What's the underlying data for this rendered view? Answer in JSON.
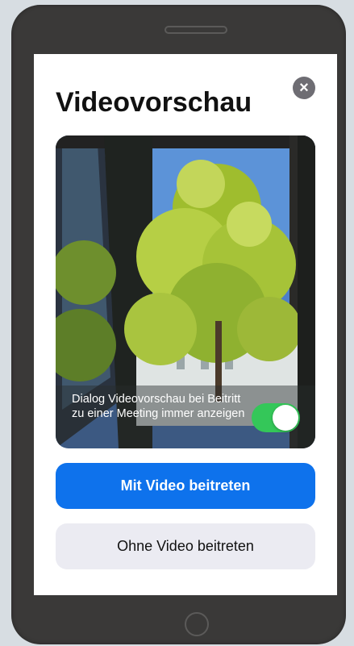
{
  "dialog": {
    "title": "Videovorschau",
    "close_icon": "close-icon"
  },
  "preview": {
    "setting_label": "Dialog Videovorschau bei Beitritt zu einer Meeting immer anzeigen",
    "toggle_on": true,
    "toggle_color": "#34c759"
  },
  "buttons": {
    "join_with_video": "Mit Video beitreten",
    "join_without_video": "Ohne Video beitreten"
  },
  "colors": {
    "primary": "#0e72ec",
    "secondary_bg": "#ebebf2"
  }
}
